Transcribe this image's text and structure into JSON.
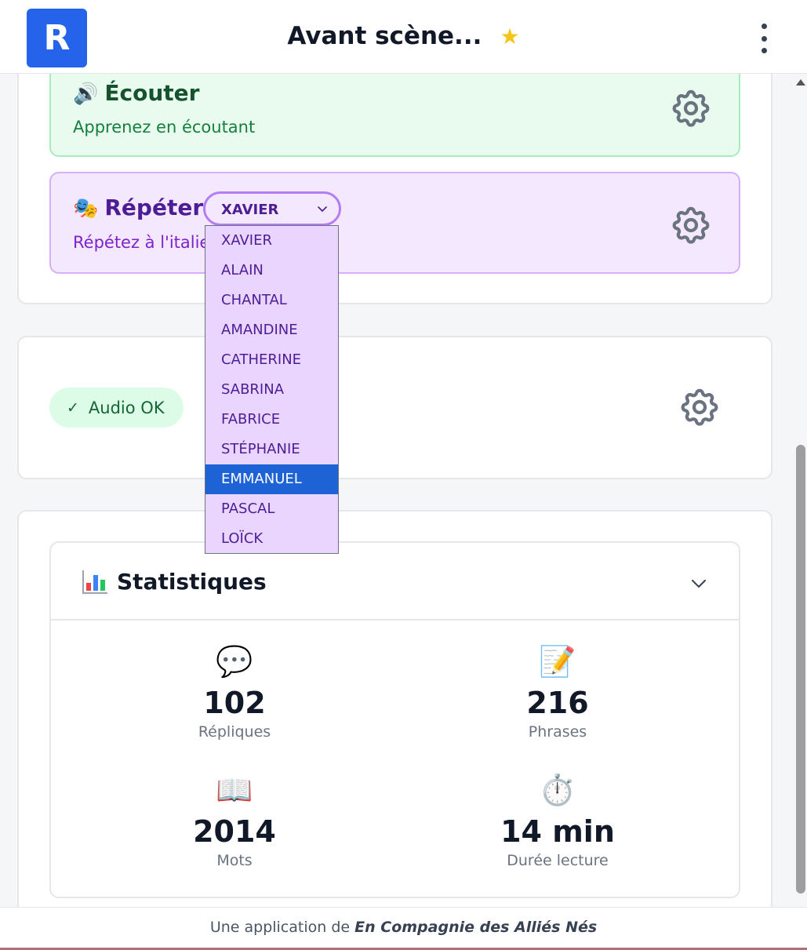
{
  "header": {
    "logo_letter": "R",
    "title": "Avant scène...",
    "star": "★",
    "star_color": "#f6c515"
  },
  "modes": {
    "listen": {
      "icon": "🔊",
      "title": "Écouter",
      "subtitle": "Apprenez en écoutant"
    },
    "repeat": {
      "icon": "🎭",
      "title": "Répéter",
      "subtitle": "Répétez à l'italie",
      "selected_character": "XAVIER"
    }
  },
  "dropdown": {
    "options": [
      "XAVIER",
      "ALAIN",
      "CHANTAL",
      "AMANDINE",
      "CATHERINE",
      "SABRINA",
      "FABRICE",
      "STÉPHANIE",
      "EMMANUEL",
      "PASCAL",
      "LOÏCK"
    ],
    "highlighted": "EMMANUEL"
  },
  "audio": {
    "check": "✓",
    "label": "Audio OK"
  },
  "stats": {
    "title": "Statistiques",
    "items": [
      {
        "icon": "💬",
        "value": "102",
        "label": "Répliques"
      },
      {
        "icon": "📝",
        "value": "216",
        "label": "Phrases"
      },
      {
        "icon": "📖",
        "value": "2014",
        "label": "Mots"
      },
      {
        "icon": "⏱️",
        "value": "14 min",
        "label": "Durée lecture"
      }
    ]
  },
  "footer": {
    "prefix": "Une application de",
    "brand": "En Compagnie des Alliés Nés"
  },
  "colors": {
    "accent": "#2563eb",
    "listen_bg": "#e8fbee",
    "repeat_bg": "#f4e8fe",
    "selected_option": "#1e63d6"
  }
}
